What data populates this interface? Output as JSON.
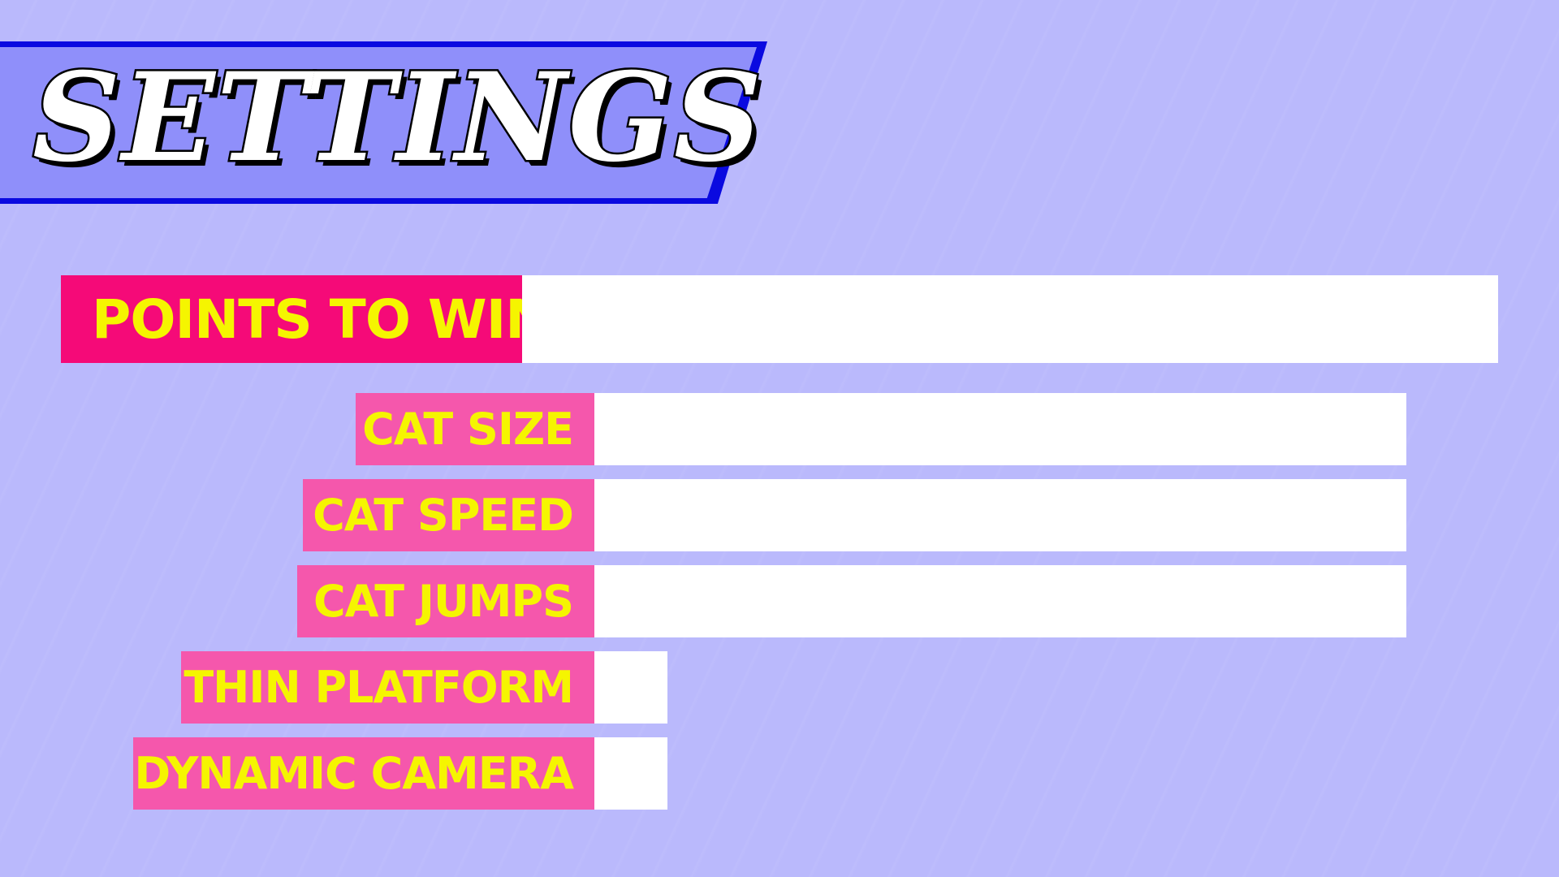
{
  "title": "SETTINGS",
  "colors": {
    "background": "#bab9fc",
    "banner_fill": "#8f8ffa",
    "banner_border": "#0a0ae0",
    "label_highlight_bg": "#f50a78",
    "label_bg": "#f557ac",
    "label_text": "#f5f500",
    "value_bg": "#ffffff"
  },
  "settings": {
    "points_to_win": {
      "label": "POINTS TO WIN",
      "selected": true
    },
    "cat_size": {
      "label": "CAT SIZE"
    },
    "cat_speed": {
      "label": "CAT SPEED"
    },
    "cat_jumps": {
      "label": "CAT JUMPS"
    },
    "thin_platform": {
      "label": "THIN PLATFORM"
    },
    "dynamic_camera": {
      "label": "DYNAMIC CAMERA"
    }
  }
}
